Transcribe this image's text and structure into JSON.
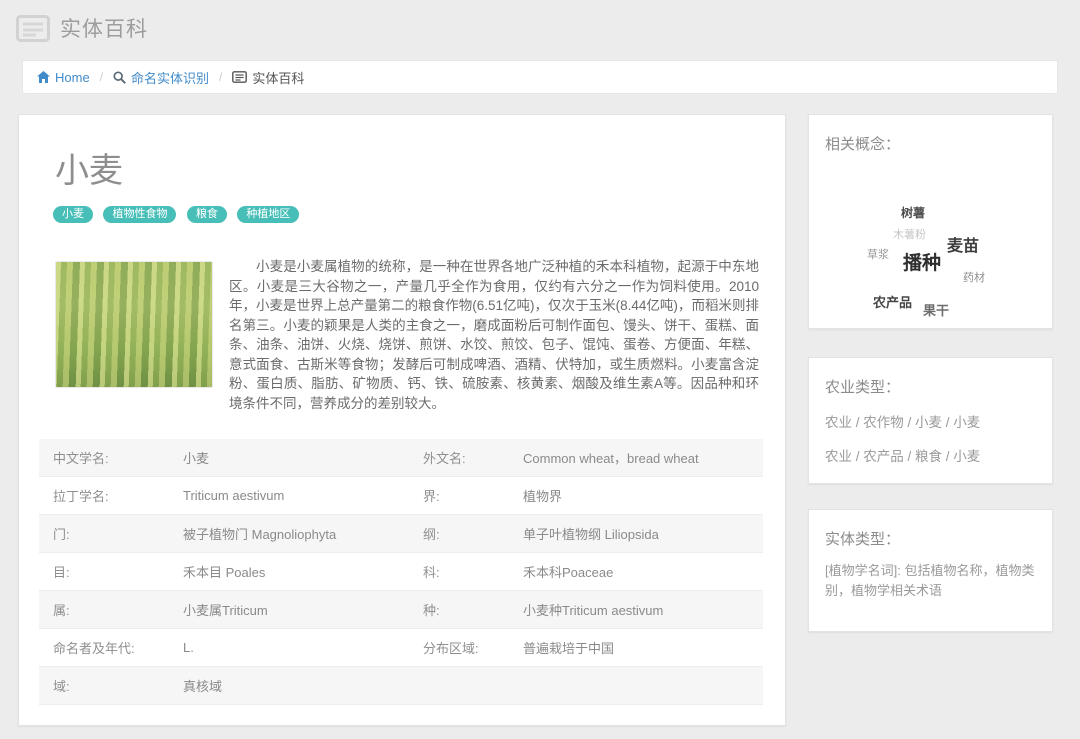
{
  "header": {
    "title": "实体百科"
  },
  "breadcrumb": {
    "separator": "/",
    "items": [
      {
        "label": "Home"
      },
      {
        "label": "命名实体识别"
      },
      {
        "label": "实体百科"
      }
    ]
  },
  "entity": {
    "title": "小麦",
    "tags": [
      "小麦",
      "植物性食物",
      "粮食",
      "种植地区"
    ],
    "description": "小麦是小麦属植物的统称，是一种在世界各地广泛种植的禾本科植物，起源于中东地区。小麦是三大谷物之一，产量几乎全作为食用，仅约有六分之一作为饲料使用。2010年，小麦是世界上总产量第二的粮食作物(6.51亿吨)，仅次于玉米(8.44亿吨)，而稻米则排名第三。小麦的颖果是人类的主食之一，磨成面粉后可制作面包、馒头、饼干、蛋糕、面条、油条、油饼、火烧、烧饼、煎饼、水饺、煎饺、包子、馄饨、蛋卷、方便面、年糕、意式面食、古斯米等食物；发酵后可制成啤酒、酒精、伏特加，或生质燃料。小麦富含淀粉、蛋白质、脂肪、矿物质、钙、铁、硫胺素、核黄素、烟酸及维生素A等。因品种和环境条件不同，营养成分的差别较大。"
  },
  "infotable": {
    "rows": [
      {
        "l1": "中文学名:",
        "v1": "小麦",
        "l2": "外文名:",
        "v2": "Common wheat，bread wheat"
      },
      {
        "l1": "拉丁学名:",
        "v1": "Triticum aestivum",
        "l2": "界:",
        "v2": "植物界"
      },
      {
        "l1": "门:",
        "v1": "被子植物门 Magnoliophyta",
        "l2": "纲:",
        "v2": "单子叶植物纲 Liliopsida"
      },
      {
        "l1": "目:",
        "v1": "禾本目 Poales",
        "l2": "科:",
        "v2": "禾本科Poaceae"
      },
      {
        "l1": "属:",
        "v1": "小麦属Triticum",
        "l2": "种:",
        "v2": "小麦种Triticum aestivum"
      },
      {
        "l1": "命名者及年代:",
        "v1": "L.",
        "l2": "分布区域:",
        "v2": "普遍栽培于中国"
      },
      {
        "l1": "域:",
        "v1": "真核域",
        "l2": "",
        "v2": ""
      }
    ]
  },
  "sidebar": {
    "related": {
      "title": "相关概念：",
      "words": [
        "树薯",
        "木薯粉",
        "麦苗",
        "草浆",
        "播种",
        "药材",
        "农产品",
        "果干"
      ]
    },
    "agri": {
      "title": "农业类型：",
      "paths": [
        "农业 / 农作物 / 小麦 / 小麦",
        "农业 / 农产品 / 粮食 / 小麦"
      ]
    },
    "entity_type": {
      "title": "实体类型：",
      "text": "[植物学名词]: 包括植物名称，植物类别，植物学相关术语"
    }
  },
  "colors": {
    "tag_teal": "#47bfb8",
    "link_blue": "#428bca",
    "page_bg": "#ececec"
  }
}
